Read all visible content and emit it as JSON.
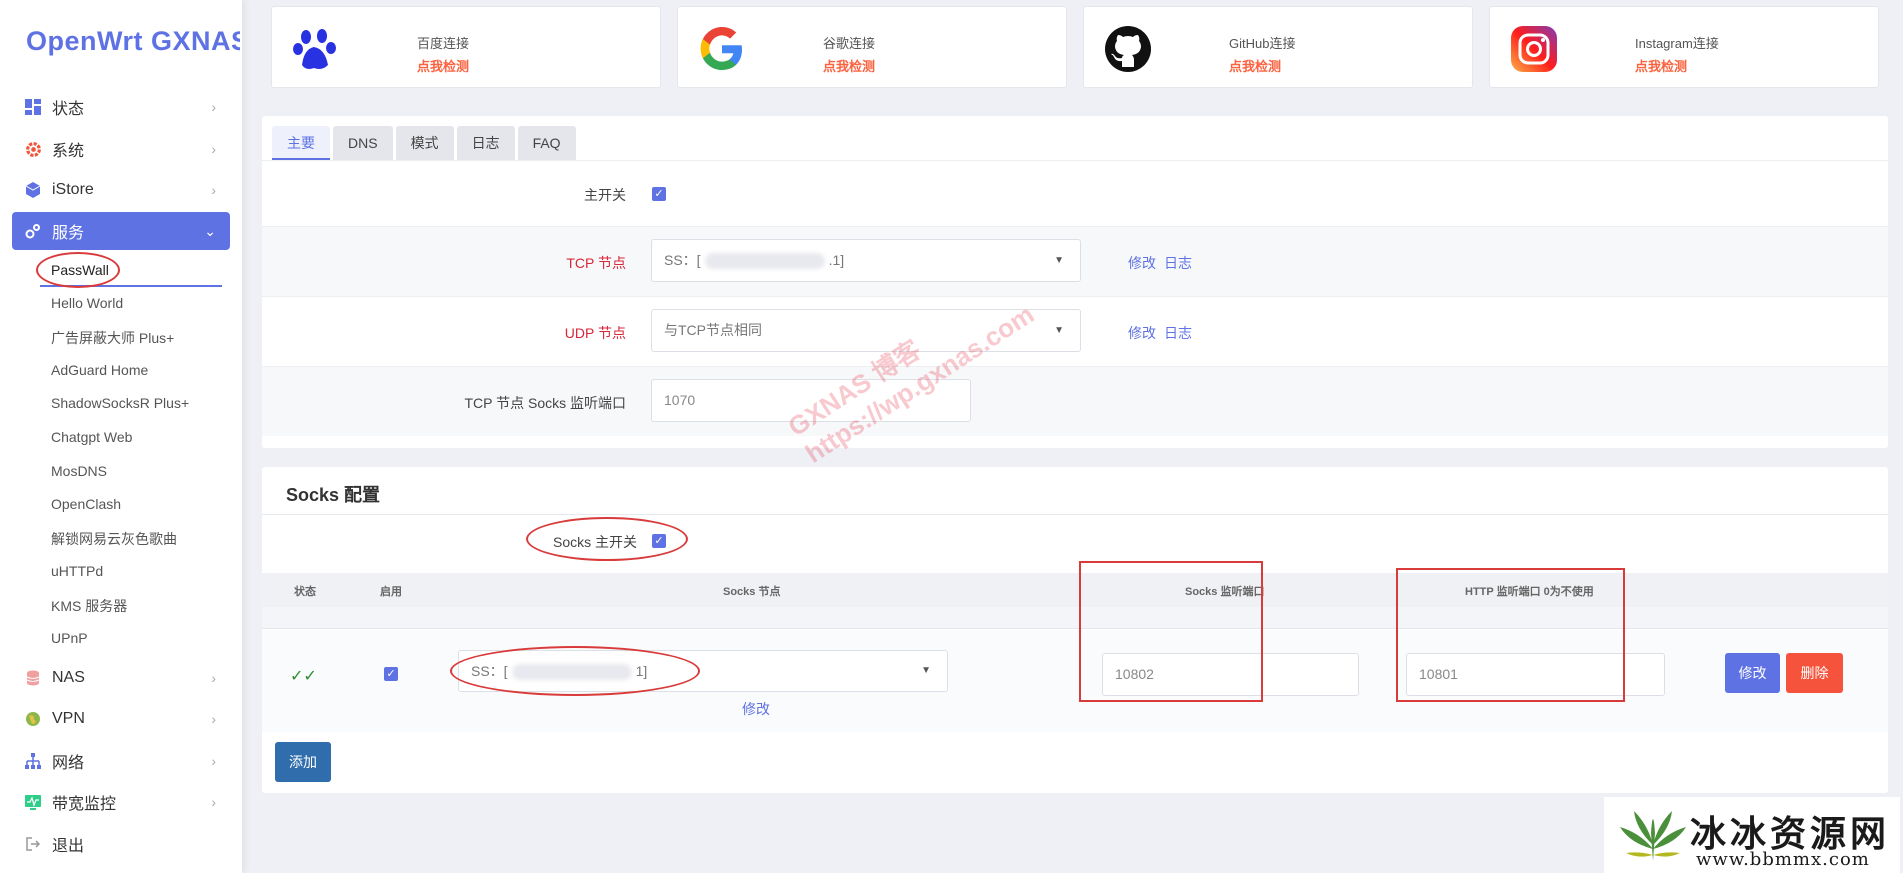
{
  "sidebar": {
    "logo": "OpenWrt GXNAS",
    "menu": [
      {
        "label": "状态",
        "icon": "dashboard-icon"
      },
      {
        "label": "系统",
        "icon": "gear-icon"
      },
      {
        "label": "iStore",
        "icon": "box-icon"
      },
      {
        "label": "服务",
        "icon": "services-icon"
      },
      {
        "label": "NAS",
        "icon": "database-icon"
      },
      {
        "label": "VPN",
        "icon": "globe-icon"
      },
      {
        "label": "网络",
        "icon": "network-icon"
      },
      {
        "label": "带宽监控",
        "icon": "monitor-icon"
      },
      {
        "label": "退出",
        "icon": "logout-icon"
      }
    ],
    "services_sub": [
      "PassWall",
      "Hello World",
      "广告屏蔽大师 Plus+",
      "AdGuard Home",
      "ShadowSocksR Plus+",
      "Chatgpt Web",
      "MosDNS",
      "OpenClash",
      "解锁网易云灰色歌曲",
      "uHTTPd",
      "KMS 服务器",
      "UPnP"
    ]
  },
  "connections": [
    {
      "title": "百度连接",
      "link": "点我检测",
      "icon": "baidu-paw-icon"
    },
    {
      "title": "谷歌连接",
      "link": "点我检测",
      "icon": "google-icon"
    },
    {
      "title": "GitHub连接",
      "link": "点我检测",
      "icon": "github-icon"
    },
    {
      "title": "Instagram连接",
      "link": "点我检测",
      "icon": "instagram-icon"
    }
  ],
  "tabs": [
    "主要",
    "DNS",
    "模式",
    "日志",
    "FAQ"
  ],
  "main": {
    "master_switch_label": "主开关",
    "tcp_node_label": "TCP 节点",
    "tcp_node_value_prefix": "SS：[",
    "tcp_node_value_suffix": ".1]",
    "udp_node_label": "UDP 节点",
    "udp_node_value": "与TCP节点相同",
    "socks_port_label": "TCP 节点 Socks 监听端口",
    "socks_port_value": "1070",
    "edit_link": "修改",
    "log_link": "日志"
  },
  "socks": {
    "title": "Socks 配置",
    "master_label": "Socks 主开关",
    "columns": [
      "状态",
      "启用",
      "Socks 节点",
      "Socks 监听端口",
      "HTTP 监听端口 0为不使用"
    ],
    "row": {
      "status": "✓✓",
      "node_prefix": "SS：[",
      "node_suffix": "1]",
      "node_edit": "修改",
      "socks_port": "10802",
      "http_port": "10801"
    },
    "edit_button": "修改",
    "delete_button": "删除",
    "add_button": "添加"
  },
  "watermark": {
    "line1": "GXNAS 博客",
    "line2": "https://wp.gxnas.com"
  },
  "brand": {
    "name": "冰冰资源网",
    "url": "www.bbmmx.com"
  },
  "colors": {
    "accent": "#5e72e4",
    "orange": "#fb6340",
    "danger": "#f5533b",
    "annotation_red": "#d93a3a"
  }
}
